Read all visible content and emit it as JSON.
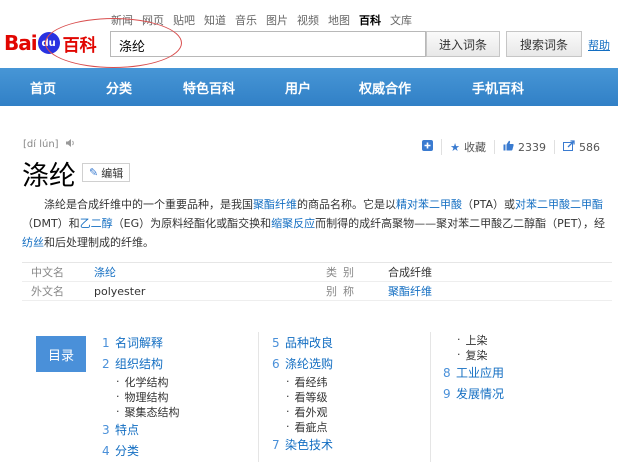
{
  "top_links": [
    "新闻",
    "网页",
    "贴吧",
    "知道",
    "音乐",
    "图片",
    "视频",
    "地图",
    "百科",
    "文库"
  ],
  "top_links_active": "百科",
  "logo": {
    "text_left": "Bai",
    "paw": "du",
    "text_right": "百科"
  },
  "search": {
    "value": "涤纶"
  },
  "buttons": {
    "enter": "进入词条",
    "search": "搜索词条",
    "help": "帮助"
  },
  "nav": [
    "首页",
    "分类",
    "特色百科",
    "用户",
    "权威合作",
    "手机百科"
  ],
  "entry": {
    "pinyin": "[dí lún]",
    "title": "涤纶",
    "edit": "编辑",
    "collect": "收藏",
    "likes": "2339",
    "shares": "586"
  },
  "summary": [
    {
      "t": "涤纶是合成纤维中的一个重要品种，是我国"
    },
    {
      "t": "聚酯纤维",
      "link": true
    },
    {
      "t": "的商品名称。它是以"
    },
    {
      "t": "精对苯二甲酸",
      "link": true
    },
    {
      "t": "（PTA）或"
    },
    {
      "t": "对苯二甲酸二甲酯",
      "link": true
    },
    {
      "t": "（DMT）和"
    },
    {
      "t": "乙二醇",
      "link": true
    },
    {
      "t": "（EG）为原料经酯化或酯交换和"
    },
    {
      "t": "缩聚反应",
      "link": true
    },
    {
      "t": "而制得的成纤高聚物——聚对苯二甲酸乙二醇酯（PET），经"
    },
    {
      "t": "纺丝",
      "link": true
    },
    {
      "t": "和后处理制成的纤维。"
    }
  ],
  "basic_info": [
    {
      "name": "中文名",
      "value": "涤纶",
      "value_link": true,
      "name2": "类别",
      "value2": "合成纤维",
      "value2_link": false
    },
    {
      "name": "外文名",
      "value": "polyester",
      "value_link": false,
      "name2": "别称",
      "value2": "聚酯纤维",
      "value2_link": true
    }
  ],
  "catalog": {
    "label": "目录",
    "col1": [
      {
        "num": "1",
        "text": "名词解释"
      },
      {
        "num": "2",
        "text": "组织结构",
        "subs": [
          "化学结构",
          "物理结构",
          "聚集态结构"
        ]
      },
      {
        "num": "3",
        "text": "特点"
      },
      {
        "num": "4",
        "text": "分类"
      }
    ],
    "col2": [
      {
        "num": "5",
        "text": "品种改良"
      },
      {
        "num": "6",
        "text": "涤纶选购",
        "subs": [
          "看经纬",
          "看等级",
          "看外观",
          "看疵点"
        ]
      },
      {
        "num": "7",
        "text": "染色技术"
      }
    ],
    "col3_subs_top": [
      "上染",
      "复染"
    ],
    "col3": [
      {
        "num": "8",
        "text": "工业应用"
      },
      {
        "num": "9",
        "text": "发展情况"
      }
    ]
  }
}
